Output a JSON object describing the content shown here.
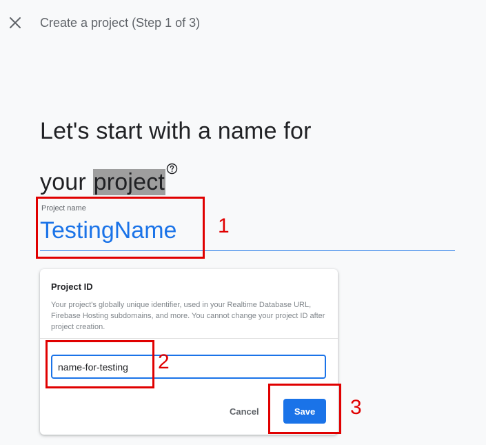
{
  "header": {
    "close_icon": "close-icon",
    "step_title": "Create a project (Step 1 of 3)"
  },
  "heading": {
    "line1": "Let's start with a name for",
    "line2_prefix": "your ",
    "line2_highlight": "project",
    "help_icon": "help-circle-icon"
  },
  "project_name": {
    "label": "Project name",
    "value": "TestingName"
  },
  "project_id_card": {
    "title": "Project ID",
    "description": "Your project's globally unique identifier, used in your Realtime Database URL, Firebase Hosting subdomains, and more. You cannot change your project ID after project creation.",
    "value": "name-for-testing",
    "cancel_label": "Cancel",
    "save_label": "Save"
  },
  "annotations": {
    "n1": "1",
    "n2": "2",
    "n3": "3",
    "color": "#e00000"
  },
  "colors": {
    "accent": "#1a73e8",
    "background": "#f8f9fa",
    "highlight": "#9e9e9e"
  }
}
